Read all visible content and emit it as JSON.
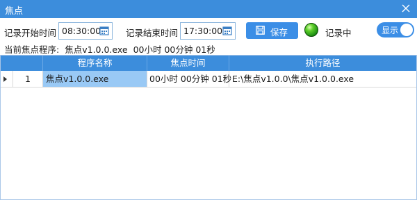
{
  "window": {
    "title": "焦点"
  },
  "toolbar": {
    "start_label": "记录开始时间",
    "start_value": "08:30:00",
    "end_label": "记录结束时间",
    "end_value": "17:30:00",
    "save_label": "保存",
    "status_label": "记录中",
    "toggle_label": "显示"
  },
  "current": {
    "label": "当前焦点程序:",
    "program": "焦点v1.0.0.exe",
    "duration": "00小时 00分钟 01秒"
  },
  "table": {
    "headers": [
      "程序名称",
      "焦点时间",
      "执行路径"
    ],
    "rows": [
      {
        "index": "1",
        "name": "焦点v1.0.0.exe",
        "time": "00小时 00分钟 01秒",
        "path": "E:\\焦点v1.0.0\\焦点v1.0.0.exe"
      }
    ]
  },
  "colors": {
    "accent": "#3c8ddc",
    "selection": "#99c9f5",
    "status_led": "#3fbf1f"
  }
}
